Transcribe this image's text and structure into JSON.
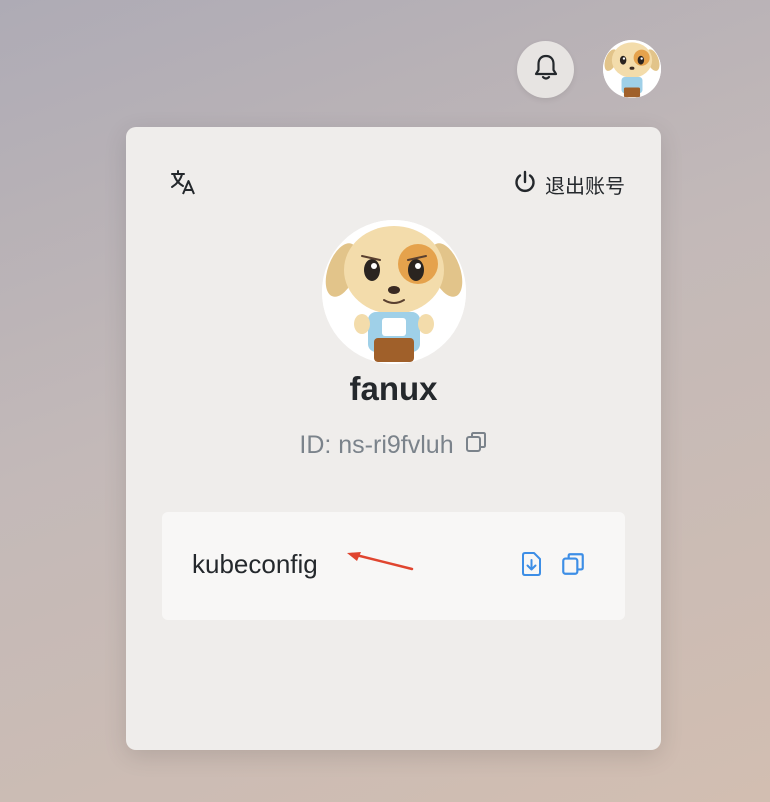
{
  "header": {
    "notification_icon": "bell-icon",
    "avatar_icon": "dog-avatar"
  },
  "panel": {
    "translate_icon": "translate-icon",
    "logout": {
      "icon": "power-icon",
      "label": "退出账号"
    },
    "user": {
      "name": "fanux",
      "id_text": "ID: ns-ri9fvluh",
      "copy_icon": "copy-icon"
    },
    "kubeconfig": {
      "label": "kubeconfig",
      "download_icon": "download-file-icon",
      "copy_icon": "copy-icon",
      "annotation": "red-arrow"
    }
  },
  "colors": {
    "text_primary": "#24282c",
    "text_secondary": "#7b838b",
    "accent_blue": "#3d8ee6",
    "annotation_red": "#e0452f"
  }
}
